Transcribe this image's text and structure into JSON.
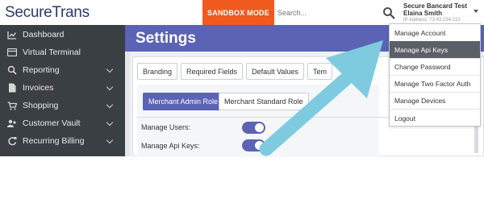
{
  "logo": {
    "text_prefix": "S",
    "text_rest": "ecureTrans"
  },
  "header": {
    "sandbox_label": "SANDBOX MODE",
    "search_placeholder": "Search...",
    "user": {
      "company": "Secure Bancard Test",
      "name": "Elaina Smith",
      "ip": "IP Address: 73.43.234.210"
    }
  },
  "sidebar": {
    "items": [
      {
        "label": "Dashboard",
        "icon": "chart-icon",
        "has_children": false
      },
      {
        "label": "Virtual Terminal",
        "icon": "terminal-icon",
        "has_children": false
      },
      {
        "label": "Reporting",
        "icon": "search-icon",
        "has_children": true
      },
      {
        "label": "Invoices",
        "icon": "invoice-icon",
        "has_children": true
      },
      {
        "label": "Shopping",
        "icon": "cart-icon",
        "has_children": true
      },
      {
        "label": "Customer Vault",
        "icon": "users-icon",
        "has_children": true
      },
      {
        "label": "Recurring Billing",
        "icon": "refresh-icon",
        "has_children": true
      }
    ]
  },
  "main": {
    "title": "Settings",
    "tabs": [
      "Branding",
      "Required Fields",
      "Default Values",
      "Tem"
    ],
    "roles": {
      "admin": "Merchant Admin Role",
      "standard": "Merchant Standard Role"
    },
    "permissions": [
      {
        "label": "Manage Users:",
        "enabled": true
      },
      {
        "label": "Manage Api Keys:",
        "enabled": true
      }
    ]
  },
  "account_menu": {
    "items": [
      {
        "label": "Manage Account",
        "active": false
      },
      {
        "label": "Manage Api Keys",
        "active": true
      },
      {
        "label": "Change Password",
        "active": false
      },
      {
        "label": "Manage Two Factor Auth",
        "active": false
      },
      {
        "label": "Manage Devices",
        "active": false
      },
      {
        "label": "Logout",
        "active": false
      }
    ]
  },
  "colors": {
    "accent": "#5b63b4",
    "sandbox": "#f05a1e",
    "sidebar": "#3a3f44",
    "arrow": "#7ecbe0"
  }
}
